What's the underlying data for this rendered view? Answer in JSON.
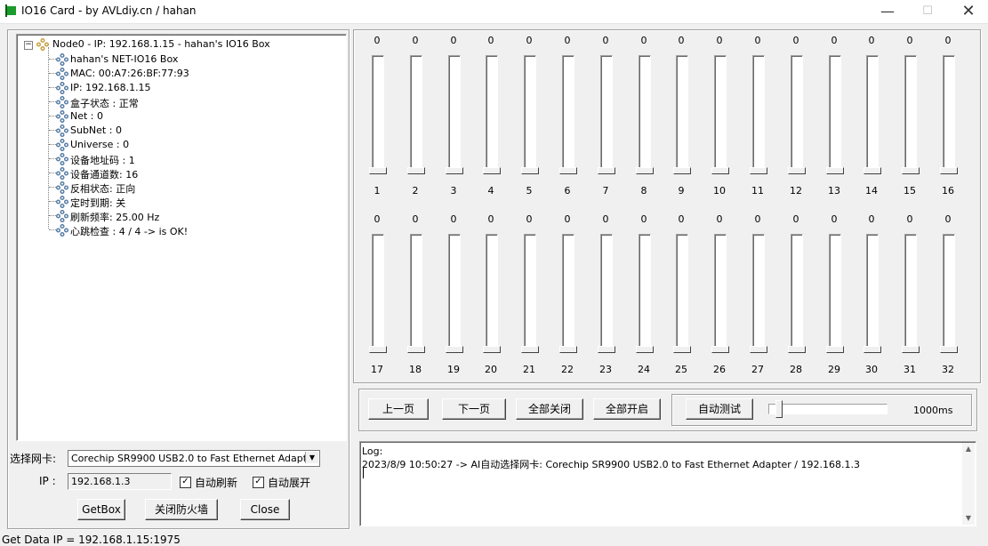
{
  "window": {
    "title": "IO16 Card - by AVLdiy.cn / hahan",
    "min_glyph": "—",
    "max_glyph": "☐",
    "close_glyph": "✕"
  },
  "tree": {
    "root": {
      "label": "Node0 - IP: 192.168.1.15 - hahan's IO16 Box",
      "expander": "−",
      "icon": "node-icon"
    },
    "items": [
      "hahan's NET-IO16 Box",
      "MAC: 00:A7:26:BF:77:93",
      "IP: 192.168.1.15",
      "盒子状态 : 正常",
      "Net : 0",
      "SubNet : 0",
      "Universe : 0",
      "设备地址码 : 1",
      "设备通道数: 16",
      "反相状态: 正向",
      "定时到期: 关",
      "刷新频率: 25.00 Hz",
      "心跳检查 : 4 / 4 -> is OK!"
    ]
  },
  "network": {
    "nic_label": "选择网卡:",
    "nic_value": "Corechip SR9900 USB2.0 to Fast Ethernet Adapter",
    "ip_label": "IP :",
    "ip_value": "192.168.1.3",
    "auto_refresh_label": "自动刷新",
    "auto_refresh_checked": true,
    "auto_expand_label": "自动展开",
    "auto_expand_checked": true,
    "getbox_label": "GetBox",
    "firewall_label": "关闭防火墙",
    "close_label": "Close"
  },
  "faders": {
    "row1": [
      {
        "num": "1",
        "val": "0"
      },
      {
        "num": "2",
        "val": "0"
      },
      {
        "num": "3",
        "val": "0"
      },
      {
        "num": "4",
        "val": "0"
      },
      {
        "num": "5",
        "val": "0"
      },
      {
        "num": "6",
        "val": "0"
      },
      {
        "num": "7",
        "val": "0"
      },
      {
        "num": "8",
        "val": "0"
      },
      {
        "num": "9",
        "val": "0"
      },
      {
        "num": "10",
        "val": "0"
      },
      {
        "num": "11",
        "val": "0"
      },
      {
        "num": "12",
        "val": "0"
      },
      {
        "num": "13",
        "val": "0"
      },
      {
        "num": "14",
        "val": "0"
      },
      {
        "num": "15",
        "val": "0"
      },
      {
        "num": "16",
        "val": "0"
      }
    ],
    "row2": [
      {
        "num": "17",
        "val": "0"
      },
      {
        "num": "18",
        "val": "0"
      },
      {
        "num": "19",
        "val": "0"
      },
      {
        "num": "20",
        "val": "0"
      },
      {
        "num": "21",
        "val": "0"
      },
      {
        "num": "22",
        "val": "0"
      },
      {
        "num": "23",
        "val": "0"
      },
      {
        "num": "24",
        "val": "0"
      },
      {
        "num": "25",
        "val": "0"
      },
      {
        "num": "26",
        "val": "0"
      },
      {
        "num": "27",
        "val": "0"
      },
      {
        "num": "28",
        "val": "0"
      },
      {
        "num": "29",
        "val": "0"
      },
      {
        "num": "30",
        "val": "0"
      },
      {
        "num": "31",
        "val": "0"
      },
      {
        "num": "32",
        "val": "0"
      }
    ]
  },
  "controls": {
    "prev_page": "上一页",
    "next_page": "下一页",
    "all_off": "全部关闭",
    "all_on": "全部开启",
    "auto_test": "自动测试",
    "interval_label": "1000ms",
    "interval_level": 0.05
  },
  "log": {
    "title": "Log:",
    "lines": [
      "2023/8/9 10:50:27 -> AI自动选择网卡: Corechip SR9900 USB2.0 to Fast Ethernet Adapter / 192.168.1.3"
    ]
  },
  "status": {
    "text": "Get Data IP = 192.168.1.15:1975"
  }
}
